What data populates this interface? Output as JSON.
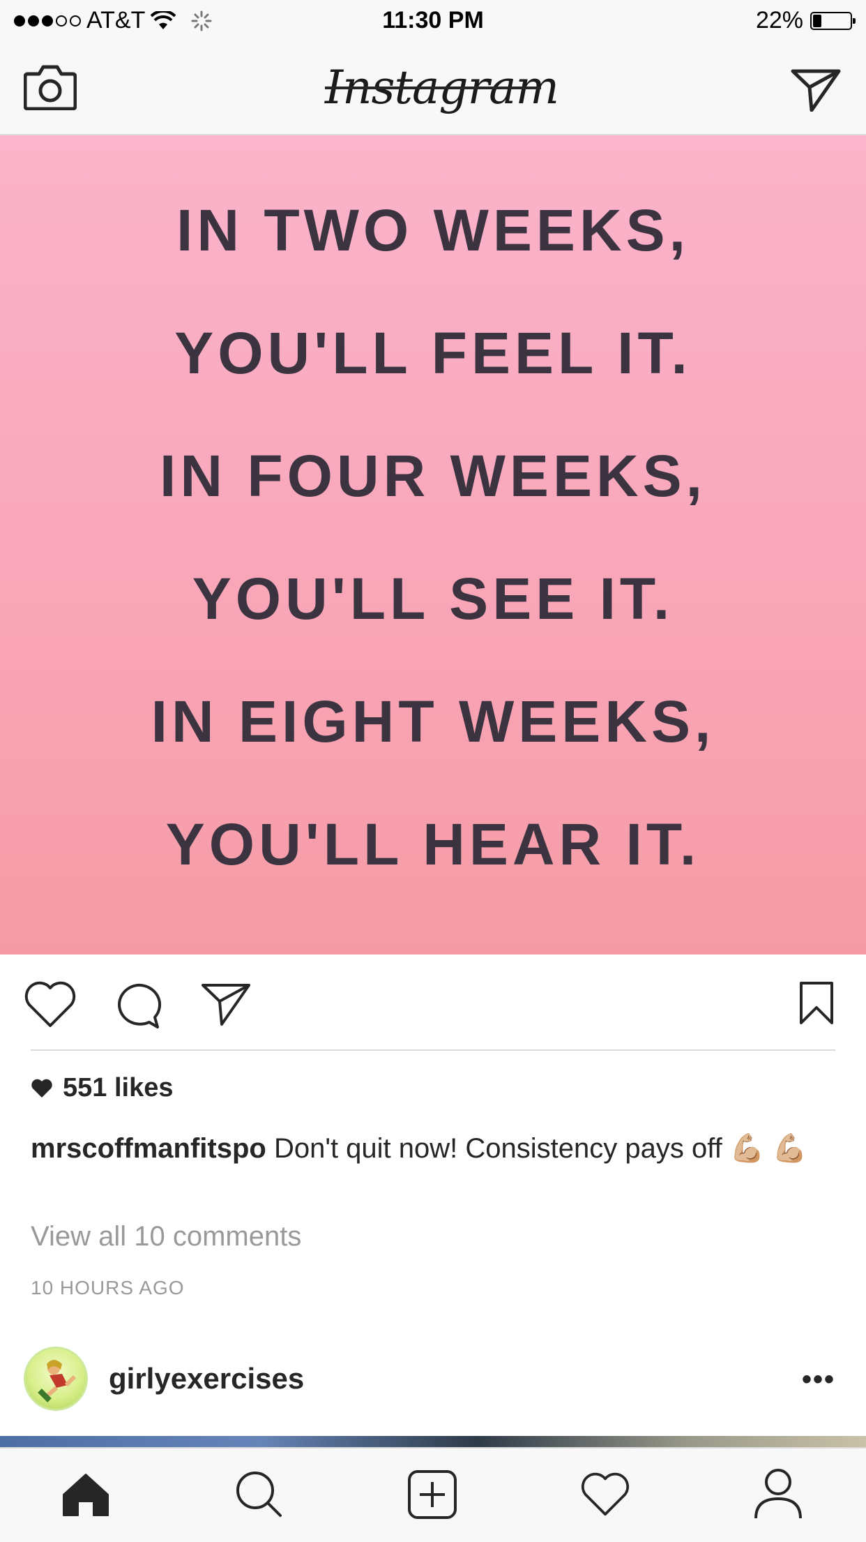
{
  "status_bar": {
    "carrier": "AT&T",
    "time": "11:30 PM",
    "battery": "22%",
    "signal_bars_filled": 3,
    "signal_bars_total": 5
  },
  "header": {
    "logo_text": "Instagram",
    "camera_icon": "camera-icon",
    "direct_icon": "paper-plane-icon"
  },
  "post": {
    "quote_lines": [
      "IN TWO WEEKS,",
      "YOU'LL FEEL IT.",
      "IN FOUR WEEKS,",
      "YOU'LL SEE IT.",
      "IN EIGHT WEEKS,",
      "YOU'LL HEAR IT."
    ],
    "likes": "551 likes",
    "username": "mrscoffmanfitspo",
    "caption": "Don't quit now! Consistency pays off 💪🏼 💪🏼",
    "view_comments": "View all 10 comments",
    "time_ago": "10 HOURS AGO",
    "colors": {
      "image_top": "#fbb4cb",
      "image_bottom": "#f69ba6",
      "quote_text": "#3b3440"
    }
  },
  "next_post": {
    "username": "girlyexercises",
    "more_label": "•••"
  },
  "tab_bar": {
    "items": [
      "home-icon",
      "search-icon",
      "add-post-icon",
      "heart-icon",
      "profile-icon"
    ]
  }
}
